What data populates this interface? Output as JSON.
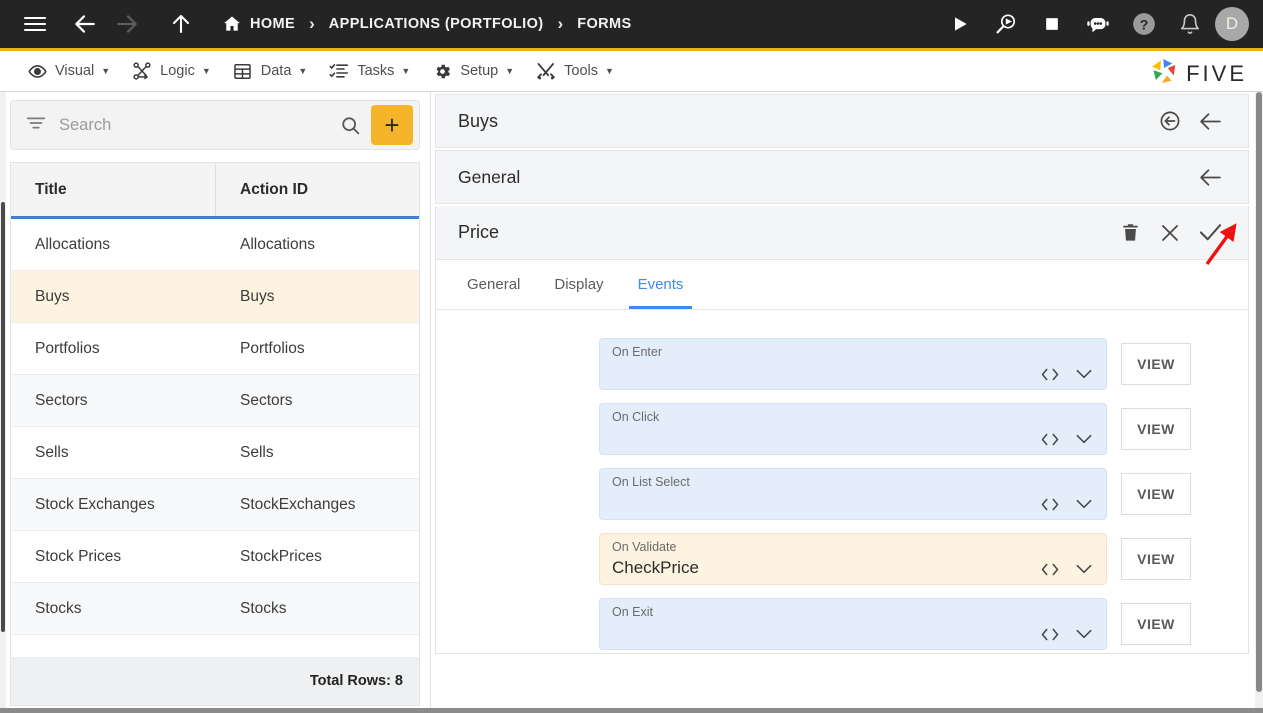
{
  "topbar": {
    "menu_icon": "hamburger-icon",
    "back_icon": "back-arrow-icon",
    "forward_icon": "forward-arrow-icon",
    "up_icon": "up-arrow-icon",
    "home_label": "HOME",
    "separator": "›",
    "breadcrumb": [
      "APPLICATIONS (PORTFOLIO)",
      "FORMS"
    ],
    "actions": [
      {
        "name": "run-icon",
        "title": "Run"
      },
      {
        "name": "debug-icon",
        "title": "Debug"
      },
      {
        "name": "stop-icon",
        "title": "Stop"
      },
      {
        "name": "chatbot-icon",
        "title": "Assistant"
      },
      {
        "name": "help-icon",
        "title": "Help"
      },
      {
        "name": "notifications-bell-icon",
        "title": "Notifications"
      }
    ],
    "avatar_initial": "D",
    "background": "#242424"
  },
  "menubar": {
    "accent": "#f0ad22",
    "items": [
      {
        "label": "Visual",
        "icon": "eye-icon"
      },
      {
        "label": "Logic",
        "icon": "flow-nodes-icon"
      },
      {
        "label": "Data",
        "icon": "table-grid-icon"
      },
      {
        "label": "Tasks",
        "icon": "checklist-icon"
      },
      {
        "label": "Setup",
        "icon": "gear-icon"
      },
      {
        "label": "Tools",
        "icon": "wrench-screwdriver-icon"
      }
    ],
    "caret": "▼",
    "brand": "FIVE"
  },
  "search": {
    "placeholder": "Search",
    "value": "",
    "filter_icon": "filter-icon",
    "search_icon": "search-icon",
    "add_label": "+",
    "add_color": "#f5b52b"
  },
  "grid": {
    "columns": [
      "Title",
      "Action ID"
    ],
    "header_underline": "#3d7fd1",
    "rows": [
      {
        "title": "Allocations",
        "action_id": "Allocations",
        "selected": false
      },
      {
        "title": "Buys",
        "action_id": "Buys",
        "selected": true
      },
      {
        "title": "Portfolios",
        "action_id": "Portfolios",
        "selected": false
      },
      {
        "title": "Sectors",
        "action_id": "Sectors",
        "selected": false
      },
      {
        "title": "Sells",
        "action_id": "Sells",
        "selected": false
      },
      {
        "title": "Stock Exchanges",
        "action_id": "StockExchanges",
        "selected": false
      },
      {
        "title": "Stock Prices",
        "action_id": "StockPrices",
        "selected": false
      },
      {
        "title": "Stocks",
        "action_id": "Stocks",
        "selected": false
      }
    ],
    "footer": "Total Rows: 8"
  },
  "form": {
    "title": "Buys",
    "title_actions": [
      {
        "name": "revert-circle-arrow-icon",
        "title": "Revert"
      },
      {
        "name": "collapse-left-arrow-icon",
        "title": "Back"
      }
    ],
    "section_title": "General",
    "section_action": {
      "name": "collapse-left-arrow-icon",
      "title": "Collapse"
    },
    "field_title": "Price",
    "field_actions": [
      {
        "name": "delete-trash-icon",
        "title": "Delete"
      },
      {
        "name": "close-x-icon",
        "title": "Cancel"
      },
      {
        "name": "save-check-icon",
        "title": "Save"
      }
    ],
    "tabs": [
      {
        "label": "General",
        "active": false
      },
      {
        "label": "Display",
        "active": false
      },
      {
        "label": "Events",
        "active": true
      }
    ],
    "active_tab_color": "#3d8bf2",
    "events": [
      {
        "label": "On Enter",
        "value": "",
        "highlighted": false,
        "view_label": "VIEW",
        "code_icon": "code-brackets-icon",
        "expand_icon": "chevron-down-icon"
      },
      {
        "label": "On Click",
        "value": "",
        "highlighted": false,
        "view_label": "VIEW",
        "code_icon": "code-brackets-icon",
        "expand_icon": "chevron-down-icon"
      },
      {
        "label": "On List Select",
        "value": "",
        "highlighted": false,
        "view_label": "VIEW",
        "code_icon": "code-brackets-icon",
        "expand_icon": "chevron-down-icon"
      },
      {
        "label": "On Validate",
        "value": "CheckPrice",
        "highlighted": true,
        "view_label": "VIEW",
        "code_icon": "code-brackets-icon",
        "expand_icon": "chevron-down-icon"
      },
      {
        "label": "On Exit",
        "value": "",
        "highlighted": false,
        "view_label": "VIEW",
        "code_icon": "code-brackets-icon",
        "expand_icon": "chevron-down-icon"
      }
    ]
  },
  "annotation": {
    "arrow_color": "#ee1111",
    "points_to": "save-check-icon"
  }
}
